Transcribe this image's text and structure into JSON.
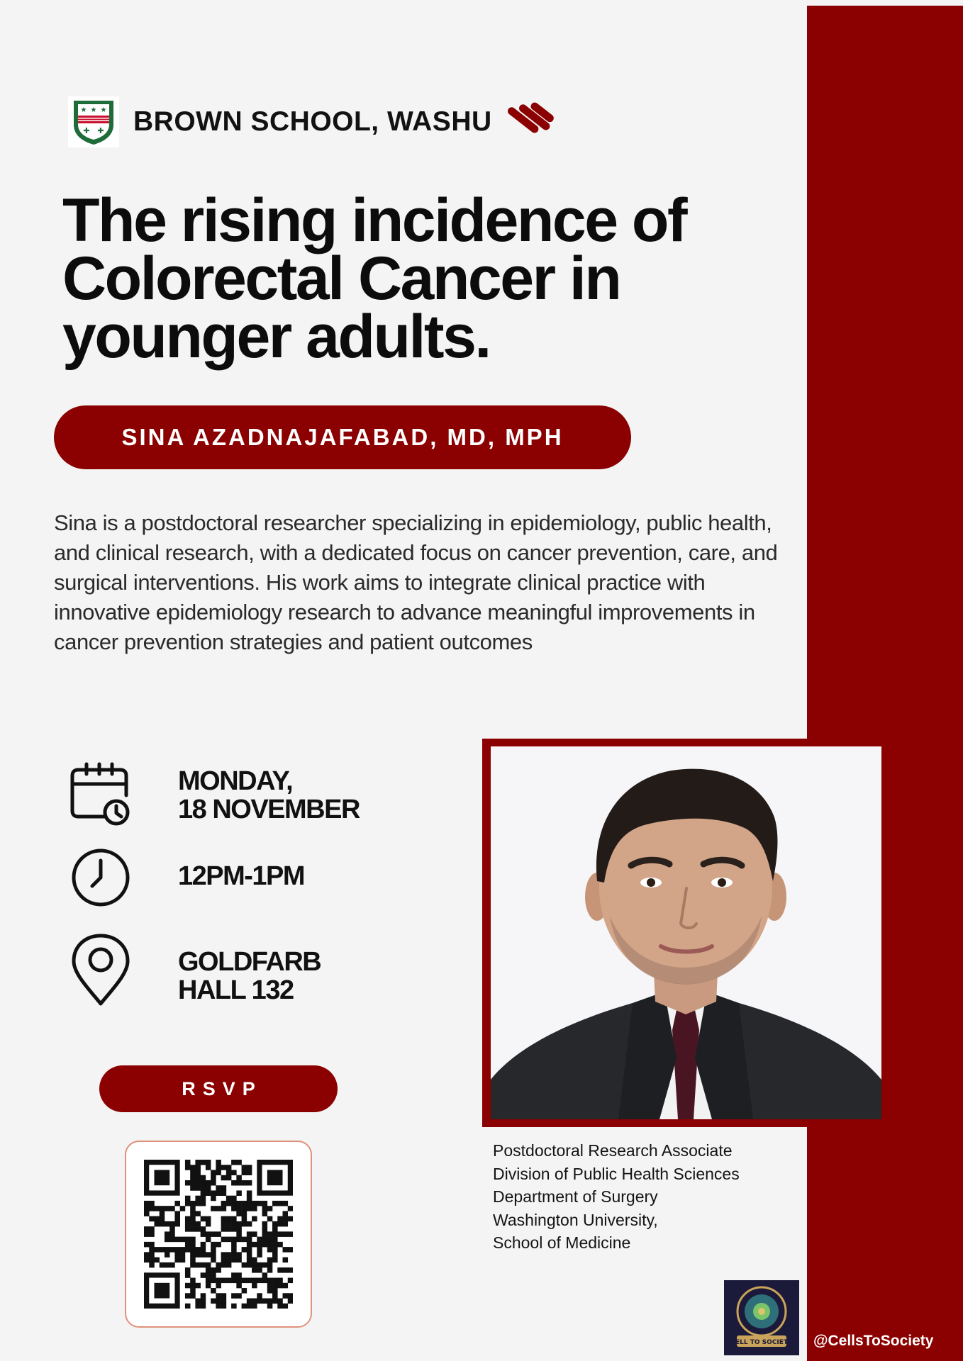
{
  "colors": {
    "brand_red": "#8b0000",
    "background": "#f4f4f4",
    "text_dark": "#111111",
    "qr_border": "#e0917a"
  },
  "header": {
    "school_name": "BROWN SCHOOL, WASHU",
    "crest_icon": "university-crest-icon",
    "brand_icon": "brand-stripes-icon"
  },
  "title": "The rising incidence of Colorectal Cancer in younger adults.",
  "speaker": {
    "name": "SINA AZADNAJAFABAD, MD, MPH"
  },
  "bio": "Sina is a postdoctoral researcher specializing in epidemiology, public health, and clinical research, with a dedicated focus on cancer prevention, care, and surgical interventions. His work aims to integrate clinical practice with innovative epidemiology research to advance meaningful improvements in cancer prevention strategies and patient outcomes",
  "event": {
    "date_line1": "MONDAY,",
    "date_line2": "18 NOVEMBER",
    "time": "12PM-1PM",
    "location_line1": "GOLDFARB",
    "location_line2": "HALL 132",
    "date_icon": "calendar-clock-icon",
    "time_icon": "clock-icon",
    "location_icon": "location-pin-icon"
  },
  "rsvp_label": "RSVP",
  "affiliation": [
    "Postdoctoral Research Associate",
    "Division of Public Health Sciences",
    "Department of Surgery",
    "Washington University,",
    "School of Medicine"
  ],
  "footer": {
    "social_handle": "@CellsToSociety",
    "logo_text": "CELL TO SOCIETY"
  }
}
